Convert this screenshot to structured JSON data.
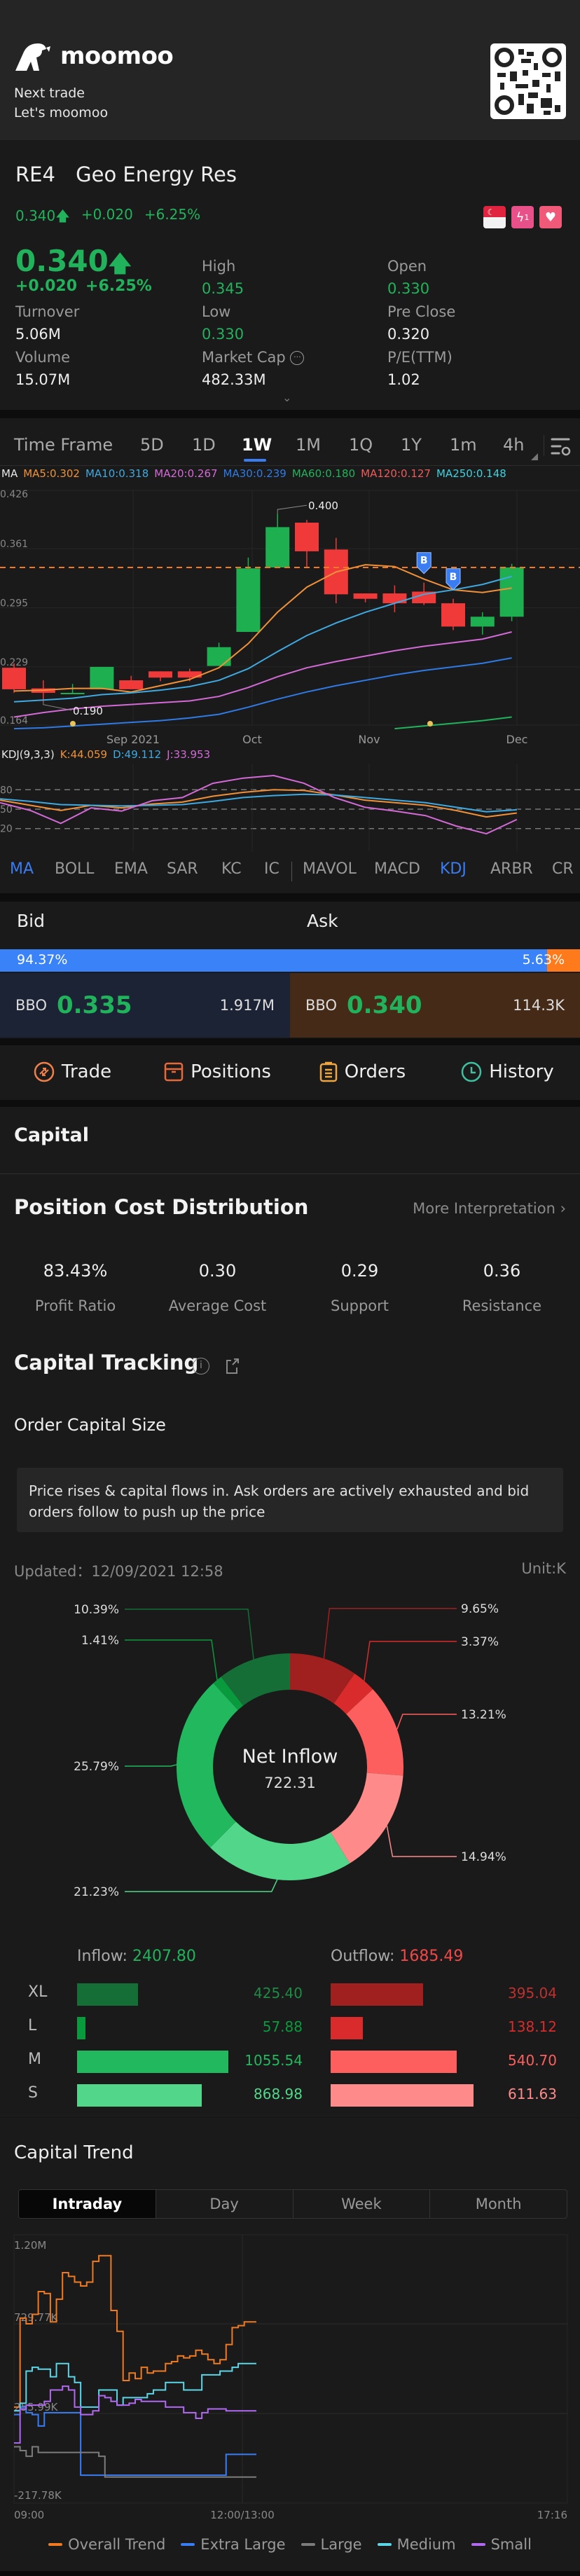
{
  "banner": {
    "brand": "moomoo",
    "tagline_1": "Next trade",
    "tagline_2": "Let's moomoo",
    "qr_icon": "qr-code-icon"
  },
  "stock": {
    "code": "RE4",
    "name": "Geo Energy Res",
    "price": "0.340",
    "change": "+0.020",
    "change_pct": "+6.25%",
    "direction_icon": "arrow-up-icon",
    "badges": [
      "singapore-flag-icon",
      "flash-level1-icon",
      "favorite-heart-icon"
    ],
    "stats": [
      {
        "label": "High",
        "value": "0.345",
        "tone": "green"
      },
      {
        "label": "Open",
        "value": "0.330",
        "tone": "green"
      },
      {
        "label": "Turnover",
        "value": "5.06M",
        "tone": "white"
      },
      {
        "label": "Low",
        "value": "0.330",
        "tone": "green"
      },
      {
        "label": "Pre Close",
        "value": "0.320",
        "tone": "white"
      },
      {
        "label": "Volume",
        "value": "15.07M",
        "tone": "white"
      },
      {
        "label": "Market Cap",
        "value": "482.33M",
        "tone": "white"
      },
      {
        "label": "P/E(TTM)",
        "value": "1.02",
        "tone": "white"
      }
    ]
  },
  "timeframe": {
    "label": "Time Frame",
    "options": [
      "5D",
      "1D",
      "1W",
      "1M",
      "1Q",
      "1Y",
      "1m",
      "4h"
    ],
    "selected": "1W"
  },
  "ma_legend": [
    {
      "label": "MA",
      "color": "#e8e8e8"
    },
    {
      "label": "MA5:0.302",
      "color": "#f0913a"
    },
    {
      "label": "MA10:0.318",
      "color": "#3fa9e0"
    },
    {
      "label": "MA20:0.267",
      "color": "#d36ad6"
    },
    {
      "label": "MA30:0.239",
      "color": "#2f7ae5"
    },
    {
      "label": "MA60:0.180",
      "color": "#21b35c"
    },
    {
      "label": "MA120:0.127",
      "color": "#f05a5a"
    },
    {
      "label": "MA250:0.148",
      "color": "#3cd2e0"
    }
  ],
  "kline": {
    "y_ticks": [
      "0.426",
      "0.361",
      "0.295",
      "0.229",
      "0.164"
    ],
    "x_ticks": [
      "Sep 2021",
      "Oct",
      "Nov",
      "Dec"
    ],
    "high_label": "0.400",
    "low_label": "0.190",
    "current_price_line": 0.34,
    "buy_markers": [
      "B",
      "B"
    ]
  },
  "kdj_legend": [
    {
      "label": "KDJ(9,3,3)",
      "color": "#e8e8e8"
    },
    {
      "label": "K:44.059",
      "color": "#f0913a"
    },
    {
      "label": "D:49.112",
      "color": "#3fa9e0"
    },
    {
      "label": "J:33.953",
      "color": "#d36ad6"
    }
  ],
  "kdj_levels": [
    "80",
    "50",
    "20"
  ],
  "indicator_tabs": [
    "MA",
    "BOLL",
    "EMA",
    "SAR",
    "KC",
    "IC",
    "MAVOL",
    "MACD",
    "KDJ",
    "ARBR",
    "CR"
  ],
  "indicator_active": [
    "MA",
    "KDJ"
  ],
  "bid_ask": {
    "bid_label": "Bid",
    "ask_label": "Ask",
    "bid_pct": "94.37%",
    "ask_pct": "5.63%",
    "bid_fraction": 0.9437,
    "bbo_label": "BBO",
    "bid_price": "0.335",
    "bid_qty": "1.917M",
    "ask_price": "0.340",
    "ask_qty": "114.3K"
  },
  "actions": [
    {
      "label": "Trade",
      "icon": "trade-icon",
      "color": "#f0804a"
    },
    {
      "label": "Positions",
      "icon": "positions-icon",
      "color": "#e8683a"
    },
    {
      "label": "Orders",
      "icon": "orders-icon",
      "color": "#f0a640"
    },
    {
      "label": "History",
      "icon": "history-clock-icon",
      "color": "#3fbfa0"
    }
  ],
  "capital": {
    "title": "Capital",
    "pcd_title": "Position Cost Distribution",
    "more": "More Interpretation",
    "pcd_stats": [
      {
        "value": "83.43%",
        "label": "Profit Ratio"
      },
      {
        "value": "0.30",
        "label": "Average Cost"
      },
      {
        "value": "0.29",
        "label": "Support"
      },
      {
        "value": "0.36",
        "label": "Resistance"
      }
    ],
    "tracking_title": "Capital Tracking",
    "order_size_title": "Order Capital Size",
    "note": "Price rises & capital flows in. Ask orders are actively exhausted and bid orders follow to push up the price",
    "updated": "Updated：12/09/2021 12:58",
    "unit": "Unit:K"
  },
  "chart_data": [
    {
      "type": "pie",
      "title": "Net Inflow",
      "center_value": "722.31",
      "slices": [
        {
          "label": "Outflow XL",
          "value": 9.65,
          "text": "9.65%",
          "color": "#a01f1f"
        },
        {
          "label": "Outflow L",
          "value": 3.37,
          "text": "3.37%",
          "color": "#d92b2b"
        },
        {
          "label": "Outflow M",
          "value": 13.21,
          "text": "13.21%",
          "color": "#fd5e5e"
        },
        {
          "label": "Outflow S",
          "value": 14.94,
          "text": "14.94%",
          "color": "#ff8a8a"
        },
        {
          "label": "Inflow S",
          "value": 21.23,
          "text": "21.23%",
          "color": "#52d689"
        },
        {
          "label": "Inflow M",
          "value": 25.79,
          "text": "25.79%",
          "color": "#22b85e"
        },
        {
          "label": "Inflow L",
          "value": 1.41,
          "text": "1.41%",
          "color": "#0a9a3e"
        },
        {
          "label": "Inflow XL",
          "value": 10.39,
          "text": "10.39%",
          "color": "#156e35"
        }
      ]
    },
    {
      "type": "bar",
      "title": "Order Capital Size",
      "categories": [
        "XL",
        "L",
        "M",
        "S"
      ],
      "inflow_label": "Inflow:",
      "inflow_total": "2407.80",
      "outflow_label": "Outflow:",
      "outflow_total": "1685.49",
      "series": [
        {
          "name": "Inflow",
          "values": [
            425.4,
            57.88,
            1055.54,
            868.98
          ],
          "text": [
            "425.40",
            "57.88",
            "1055.54",
            "868.98"
          ],
          "colors": [
            "#156e35",
            "#0a9a3e",
            "#22b85e",
            "#52d689"
          ]
        },
        {
          "name": "Outflow",
          "values": [
            395.04,
            138.12,
            540.7,
            611.63
          ],
          "text": [
            "395.04",
            "138.12",
            "540.70",
            "611.63"
          ],
          "colors": [
            "#a01f1f",
            "#d92b2b",
            "#fd5e5e",
            "#ff8a8a"
          ]
        }
      ]
    },
    {
      "type": "line",
      "title": "Capital Trend",
      "y_ticks": [
        "1.20M",
        "729.77K",
        "255.99K",
        "-217.78K"
      ],
      "ylim": [
        -217.78,
        1200
      ],
      "x_ticks": [
        "09:00",
        "12:00/13:00",
        "17:16"
      ],
      "series": [
        {
          "name": "Overall Trend",
          "color": "#f07a22",
          "values": [
            290,
            760,
            730,
            780,
            900,
            890,
            740,
            860,
            1000,
            980,
            950,
            930,
            950,
            1060,
            1090,
            1090,
            800,
            690,
            430,
            470,
            440,
            500,
            470,
            480,
            480,
            520,
            530,
            560,
            550,
            560,
            590,
            570,
            540,
            520,
            540,
            620,
            710,
            720,
            740,
            740,
            740
          ]
        },
        {
          "name": "Extra Large",
          "color": "#3a7cf2",
          "values": [
            250,
            290,
            260,
            250,
            190,
            260,
            260,
            260,
            260,
            260,
            260,
            -70,
            -70,
            -70,
            -70,
            -70,
            -70,
            -70,
            -70,
            -70,
            -70,
            -70,
            -70,
            -70,
            -70,
            -70,
            -70,
            -70,
            -70,
            -70,
            -70,
            -70,
            -70,
            -70,
            -70,
            40,
            40,
            40,
            40,
            40,
            40
          ]
        },
        {
          "name": "Large",
          "color": "#7c7c7c",
          "values": [
            80,
            60,
            30,
            80,
            50,
            50,
            50,
            50,
            50,
            50,
            50,
            50,
            50,
            50,
            30,
            -80,
            -80,
            -80,
            -80,
            -80,
            -80,
            -80,
            -80,
            -80,
            -80,
            -80,
            -80,
            -80,
            -80,
            -80,
            -80,
            -80,
            -80,
            -80,
            -80,
            -80,
            -80,
            -80,
            -80,
            -80,
            -80
          ]
        },
        {
          "name": "Medium",
          "color": "#5cd6e6",
          "values": [
            270,
            310,
            480,
            500,
            490,
            490,
            450,
            520,
            520,
            450,
            420,
            290,
            290,
            290,
            380,
            380,
            380,
            300,
            340,
            340,
            340,
            340,
            360,
            380,
            380,
            420,
            420,
            420,
            380,
            380,
            380,
            460,
            460,
            460,
            480,
            480,
            500,
            520,
            520,
            520,
            520
          ]
        },
        {
          "name": "Small",
          "color": "#b069f0",
          "values": [
            100,
            280,
            300,
            300,
            300,
            320,
            380,
            380,
            400,
            380,
            290,
            250,
            250,
            270,
            350,
            340,
            320,
            300,
            300,
            310,
            330,
            320,
            320,
            320,
            320,
            290,
            290,
            290,
            260,
            260,
            230,
            260,
            280,
            280,
            280,
            270,
            270,
            270,
            270,
            270,
            270
          ]
        }
      ]
    }
  ],
  "capital_trend": {
    "tabs": [
      "Intraday",
      "Day",
      "Week",
      "Month"
    ],
    "selected": "Intraday",
    "legend": [
      "Overall Trend",
      "Extra Large",
      "Large",
      "Medium",
      "Small"
    ]
  }
}
